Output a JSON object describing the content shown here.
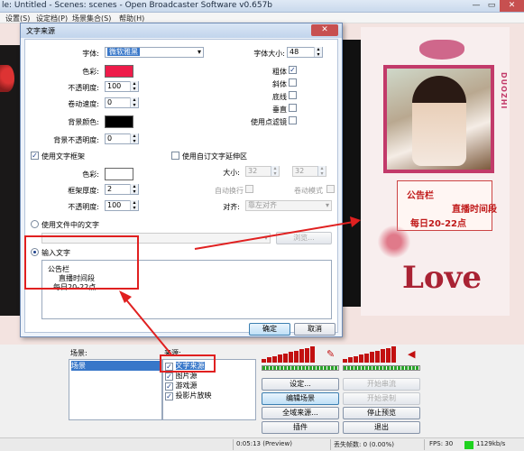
{
  "window": {
    "title": "le: Untitled - Scenes: scenes - Open Broadcaster Software v0.657b",
    "min": "—",
    "max": "▭",
    "close": "✕"
  },
  "menu": [
    "设置(S)",
    "设定档(P)",
    "场景集合(S)",
    "帮助(H)"
  ],
  "preview": {
    "side_text": "DUOZHI",
    "notice_title": "公告栏",
    "notice_line1": "直播时间段",
    "notice_line2": "每日20-22点",
    "love": "Love"
  },
  "dialog": {
    "title": "文字来源",
    "font_label": "字体:",
    "font_value": "微软雅黑",
    "font_size_label": "字体大小:",
    "font_size_value": "48",
    "color_label": "色彩:",
    "color_value": "#ee1c4a",
    "opacity_label": "不透明度:",
    "opacity_value": "100",
    "scroll_speed_label": "卷动速度:",
    "scroll_speed_value": "0",
    "bg_color_label": "背景颜色:",
    "bg_color_value": "#000000",
    "bg_opacity_label": "背景不透明度:",
    "bg_opacity_value": "0",
    "bold_label": "粗体",
    "bold_checked": "✓",
    "italic_label": "斜体",
    "underline_label": "底线",
    "vertical_label": "垂直",
    "filter_label": "使用点滤镜",
    "outline_check_label": "使用文字框架",
    "outline_checked": "✓",
    "outline_color_label": "色彩:",
    "outline_color_value": "#ffffff",
    "outline_thickness_label": "框架厚度:",
    "outline_thickness_value": "2",
    "outline_opacity_label": "不透明度:",
    "outline_opacity_value": "100",
    "custom_extent_label": "使用自订文字延伸区",
    "size_label": "大小:",
    "size_w": "32",
    "size_h": "32",
    "wrap_label": "自动换行",
    "scroll_mode_label": "卷动模式",
    "align_label": "对齐:",
    "align_value": "靠左对齐",
    "use_file_label": "使用文件中的文字",
    "browse_label": "浏览...",
    "input_text_label": "输入文字",
    "input_line1": "公告栏",
    "input_line2": "直播时间段",
    "input_line3": "每日20-22点",
    "ok_label": "确定",
    "cancel_label": "取消"
  },
  "bottom": {
    "scenes_label": "场景:",
    "scenes": [
      "场景"
    ],
    "sources_label": "来源:",
    "sources": [
      {
        "label": "文字来源",
        "checked": "✓"
      },
      {
        "label": "图片源",
        "checked": "✓"
      },
      {
        "label": "游戏源",
        "checked": "✓"
      },
      {
        "label": "投影片放映",
        "checked": "✓"
      }
    ],
    "buttons": {
      "settings": "设定...",
      "start_stream": "开始串流",
      "edit_scene": "编辑场景",
      "start_record": "开始录制",
      "global_sources": "全域来源...",
      "stop_preview": "停止预览",
      "plugins": "插件",
      "exit": "退出"
    }
  },
  "status": {
    "time": "0:05:13 (Preview)",
    "dropped": "丢失帧数: 0 (0.00%)",
    "fps": "FPS: 30",
    "bitrate": "1129kb/s"
  }
}
